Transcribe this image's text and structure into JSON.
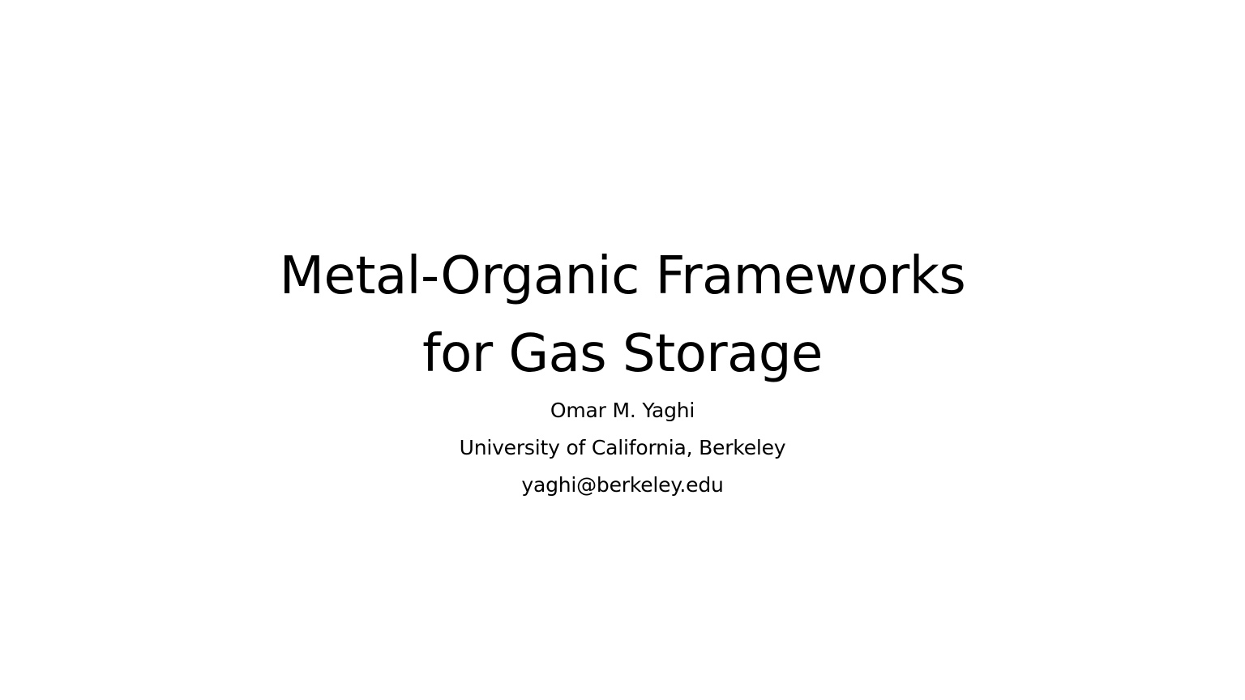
{
  "slide": {
    "title_lines": [
      "Metal-Organic Frameworks",
      "for Gas Storage"
    ],
    "author": "Omar M. Yaghi",
    "affiliation": "University of California, Berkeley",
    "email": "yaghi@berkeley.edu",
    "background_color": "#ffffff",
    "text_color": "#000000"
  }
}
